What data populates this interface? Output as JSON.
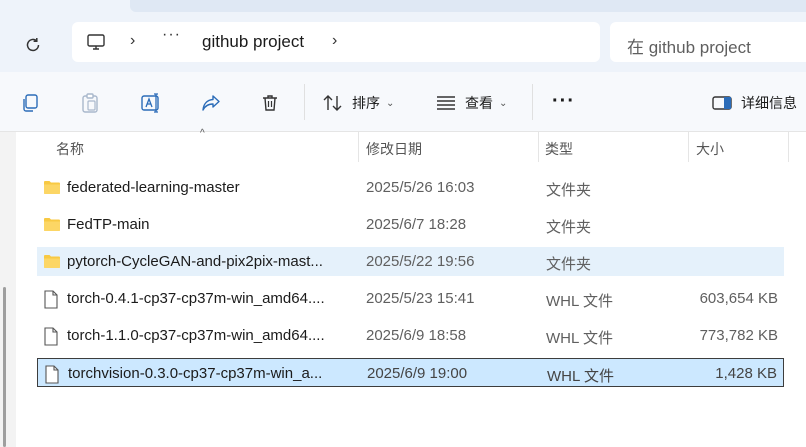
{
  "address": {
    "breadcrumb": "github project",
    "ellipsis": "···",
    "search_placeholder": "在 github project"
  },
  "toolbar": {
    "sort_label": "排序",
    "view_label": "查看",
    "details_label": "详细信息",
    "more_label": "···"
  },
  "columns": {
    "name": "名称",
    "modified": "修改日期",
    "type": "类型",
    "size": "大小"
  },
  "files": [
    {
      "name": "federated-learning-master",
      "modified": "2025/5/26 16:03",
      "type": "文件夹",
      "size": "",
      "icon": "folder-icon",
      "state": "normal"
    },
    {
      "name": "FedTP-main",
      "modified": "2025/6/7 18:28",
      "type": "文件夹",
      "size": "",
      "icon": "folder-icon",
      "state": "normal"
    },
    {
      "name": "pytorch-CycleGAN-and-pix2pix-mast...",
      "modified": "2025/5/22 19:56",
      "type": "文件夹",
      "size": "",
      "icon": "folder-icon",
      "state": "hover"
    },
    {
      "name": "torch-0.4.1-cp37-cp37m-win_amd64....",
      "modified": "2025/5/23 15:41",
      "type": "WHL 文件",
      "size": "603,654 KB",
      "icon": "file-icon",
      "state": "normal"
    },
    {
      "name": "torch-1.1.0-cp37-cp37m-win_amd64....",
      "modified": "2025/6/9 18:58",
      "type": "WHL 文件",
      "size": "773,782 KB",
      "icon": "file-icon",
      "state": "normal"
    },
    {
      "name": "torchvision-0.3.0-cp37-cp37m-win_a...",
      "modified": "2025/6/9 19:00",
      "type": "WHL 文件",
      "size": "1,428 KB",
      "icon": "file-icon",
      "state": "selected"
    }
  ],
  "colors": {
    "folder": "#f8c943",
    "accent": "#005fb8",
    "hover_row": "#e5f1fb",
    "selected_row": "#cce8ff"
  }
}
